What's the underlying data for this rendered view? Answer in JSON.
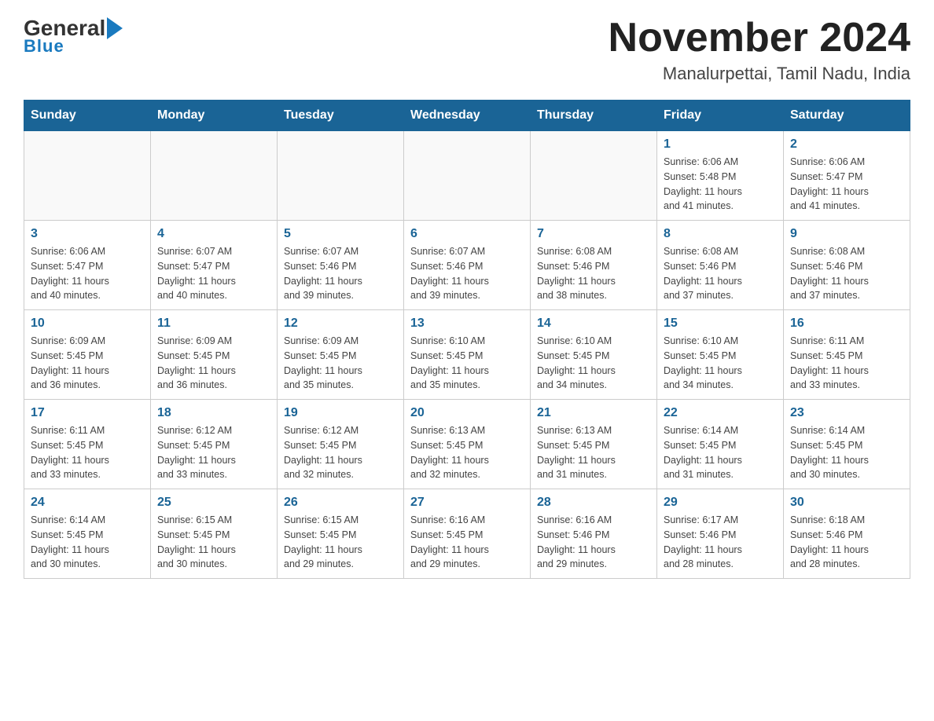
{
  "header": {
    "logo_general": "General",
    "logo_blue": "Blue",
    "month_title": "November 2024",
    "location": "Manalurpettai, Tamil Nadu, India"
  },
  "days_of_week": [
    "Sunday",
    "Monday",
    "Tuesday",
    "Wednesday",
    "Thursday",
    "Friday",
    "Saturday"
  ],
  "weeks": [
    [
      {
        "day": "",
        "info": ""
      },
      {
        "day": "",
        "info": ""
      },
      {
        "day": "",
        "info": ""
      },
      {
        "day": "",
        "info": ""
      },
      {
        "day": "",
        "info": ""
      },
      {
        "day": "1",
        "info": "Sunrise: 6:06 AM\nSunset: 5:48 PM\nDaylight: 11 hours\nand 41 minutes."
      },
      {
        "day": "2",
        "info": "Sunrise: 6:06 AM\nSunset: 5:47 PM\nDaylight: 11 hours\nand 41 minutes."
      }
    ],
    [
      {
        "day": "3",
        "info": "Sunrise: 6:06 AM\nSunset: 5:47 PM\nDaylight: 11 hours\nand 40 minutes."
      },
      {
        "day": "4",
        "info": "Sunrise: 6:07 AM\nSunset: 5:47 PM\nDaylight: 11 hours\nand 40 minutes."
      },
      {
        "day": "5",
        "info": "Sunrise: 6:07 AM\nSunset: 5:46 PM\nDaylight: 11 hours\nand 39 minutes."
      },
      {
        "day": "6",
        "info": "Sunrise: 6:07 AM\nSunset: 5:46 PM\nDaylight: 11 hours\nand 39 minutes."
      },
      {
        "day": "7",
        "info": "Sunrise: 6:08 AM\nSunset: 5:46 PM\nDaylight: 11 hours\nand 38 minutes."
      },
      {
        "day": "8",
        "info": "Sunrise: 6:08 AM\nSunset: 5:46 PM\nDaylight: 11 hours\nand 37 minutes."
      },
      {
        "day": "9",
        "info": "Sunrise: 6:08 AM\nSunset: 5:46 PM\nDaylight: 11 hours\nand 37 minutes."
      }
    ],
    [
      {
        "day": "10",
        "info": "Sunrise: 6:09 AM\nSunset: 5:45 PM\nDaylight: 11 hours\nand 36 minutes."
      },
      {
        "day": "11",
        "info": "Sunrise: 6:09 AM\nSunset: 5:45 PM\nDaylight: 11 hours\nand 36 minutes."
      },
      {
        "day": "12",
        "info": "Sunrise: 6:09 AM\nSunset: 5:45 PM\nDaylight: 11 hours\nand 35 minutes."
      },
      {
        "day": "13",
        "info": "Sunrise: 6:10 AM\nSunset: 5:45 PM\nDaylight: 11 hours\nand 35 minutes."
      },
      {
        "day": "14",
        "info": "Sunrise: 6:10 AM\nSunset: 5:45 PM\nDaylight: 11 hours\nand 34 minutes."
      },
      {
        "day": "15",
        "info": "Sunrise: 6:10 AM\nSunset: 5:45 PM\nDaylight: 11 hours\nand 34 minutes."
      },
      {
        "day": "16",
        "info": "Sunrise: 6:11 AM\nSunset: 5:45 PM\nDaylight: 11 hours\nand 33 minutes."
      }
    ],
    [
      {
        "day": "17",
        "info": "Sunrise: 6:11 AM\nSunset: 5:45 PM\nDaylight: 11 hours\nand 33 minutes."
      },
      {
        "day": "18",
        "info": "Sunrise: 6:12 AM\nSunset: 5:45 PM\nDaylight: 11 hours\nand 33 minutes."
      },
      {
        "day": "19",
        "info": "Sunrise: 6:12 AM\nSunset: 5:45 PM\nDaylight: 11 hours\nand 32 minutes."
      },
      {
        "day": "20",
        "info": "Sunrise: 6:13 AM\nSunset: 5:45 PM\nDaylight: 11 hours\nand 32 minutes."
      },
      {
        "day": "21",
        "info": "Sunrise: 6:13 AM\nSunset: 5:45 PM\nDaylight: 11 hours\nand 31 minutes."
      },
      {
        "day": "22",
        "info": "Sunrise: 6:14 AM\nSunset: 5:45 PM\nDaylight: 11 hours\nand 31 minutes."
      },
      {
        "day": "23",
        "info": "Sunrise: 6:14 AM\nSunset: 5:45 PM\nDaylight: 11 hours\nand 30 minutes."
      }
    ],
    [
      {
        "day": "24",
        "info": "Sunrise: 6:14 AM\nSunset: 5:45 PM\nDaylight: 11 hours\nand 30 minutes."
      },
      {
        "day": "25",
        "info": "Sunrise: 6:15 AM\nSunset: 5:45 PM\nDaylight: 11 hours\nand 30 minutes."
      },
      {
        "day": "26",
        "info": "Sunrise: 6:15 AM\nSunset: 5:45 PM\nDaylight: 11 hours\nand 29 minutes."
      },
      {
        "day": "27",
        "info": "Sunrise: 6:16 AM\nSunset: 5:45 PM\nDaylight: 11 hours\nand 29 minutes."
      },
      {
        "day": "28",
        "info": "Sunrise: 6:16 AM\nSunset: 5:46 PM\nDaylight: 11 hours\nand 29 minutes."
      },
      {
        "day": "29",
        "info": "Sunrise: 6:17 AM\nSunset: 5:46 PM\nDaylight: 11 hours\nand 28 minutes."
      },
      {
        "day": "30",
        "info": "Sunrise: 6:18 AM\nSunset: 5:46 PM\nDaylight: 11 hours\nand 28 minutes."
      }
    ]
  ]
}
